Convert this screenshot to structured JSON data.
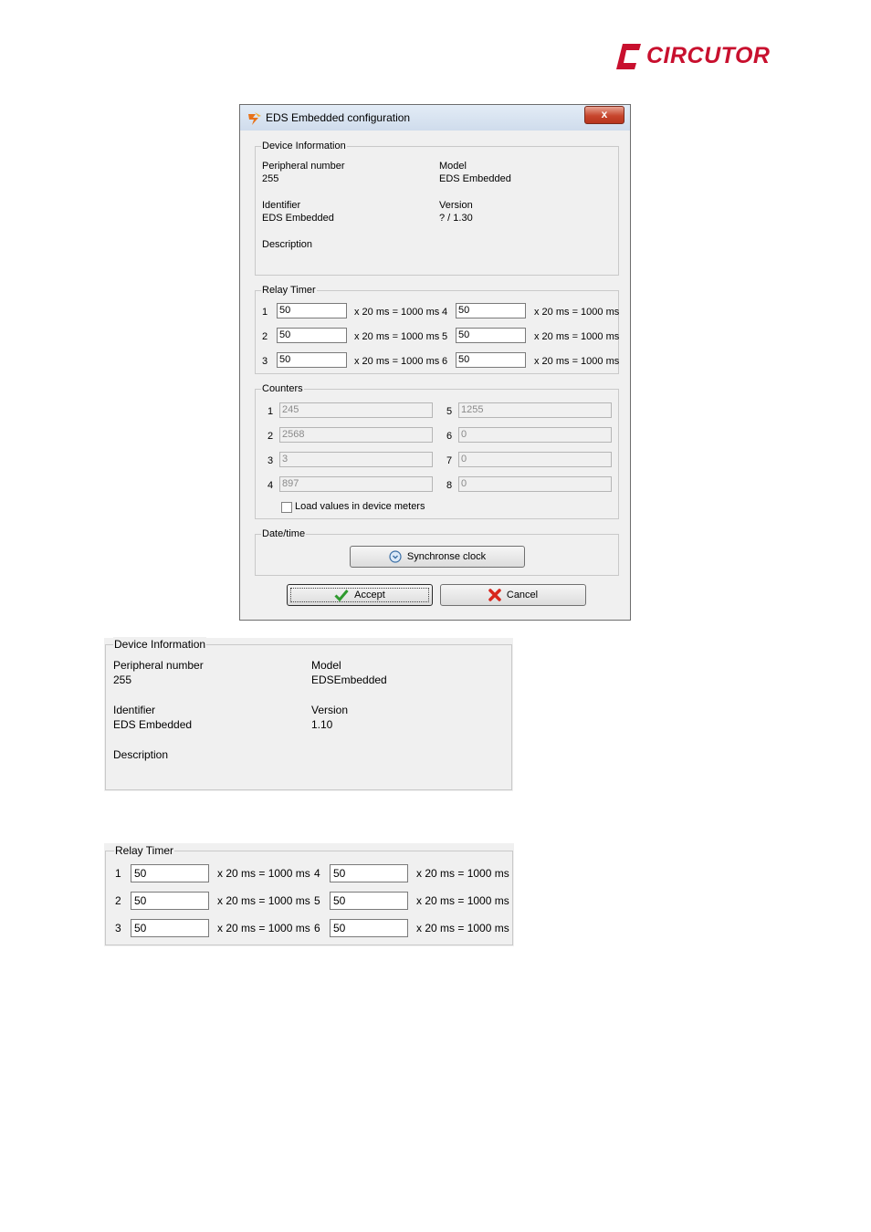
{
  "logo": {
    "text": "CIRCUTOR",
    "color": "#c8102e"
  },
  "dialog": {
    "title": "EDS Embedded configuration",
    "close_label": "x",
    "device_info": {
      "group_label": "Device Information",
      "peripheral_label": "Peripheral number",
      "peripheral_value": "255",
      "model_label": "Model",
      "model_value": "EDS Embedded",
      "identifier_label": "Identifier",
      "identifier_value": "EDS Embedded",
      "version_label": "Version",
      "version_value": "? / 1.30",
      "description_label": "Description"
    },
    "relay_timer": {
      "group_label": "Relay Timer",
      "unit_text": "x 20 ms = 1000 ms",
      "relays": [
        {
          "num": "1",
          "value": "50"
        },
        {
          "num": "2",
          "value": "50"
        },
        {
          "num": "3",
          "value": "50"
        },
        {
          "num": "4",
          "value": "50"
        },
        {
          "num": "5",
          "value": "50"
        },
        {
          "num": "6",
          "value": "50"
        }
      ]
    },
    "counters": {
      "group_label": "Counters",
      "items": [
        {
          "num": "1",
          "value": "245"
        },
        {
          "num": "2",
          "value": "2568"
        },
        {
          "num": "3",
          "value": "3"
        },
        {
          "num": "4",
          "value": "897"
        },
        {
          "num": "5",
          "value": "1255"
        },
        {
          "num": "6",
          "value": "0"
        },
        {
          "num": "7",
          "value": "0"
        },
        {
          "num": "8",
          "value": "0"
        }
      ],
      "load_label": "Load values in device meters"
    },
    "datetime": {
      "group_label": "Date/time",
      "sync_label": "Synchronse clock"
    },
    "accept_label": "Accept",
    "cancel_label": "Cancel"
  },
  "zoom_device_info": {
    "group_label": "Device Information",
    "peripheral_label": "Peripheral number",
    "peripheral_value": "255",
    "model_label": "Model",
    "model_value": "EDSEmbedded",
    "identifier_label": "Identifier",
    "identifier_value": "EDS Embedded",
    "version_label": "Version",
    "version_value": "1.10",
    "description_label": "Description"
  },
  "zoom_relay_timer": {
    "group_label": "Relay Timer",
    "unit_text": "x 20 ms = 1000 ms",
    "relays": [
      {
        "num": "1",
        "value": "50"
      },
      {
        "num": "2",
        "value": "50"
      },
      {
        "num": "3",
        "value": "50"
      },
      {
        "num": "4",
        "value": "50"
      },
      {
        "num": "5",
        "value": "50"
      },
      {
        "num": "6",
        "value": "50"
      }
    ]
  }
}
